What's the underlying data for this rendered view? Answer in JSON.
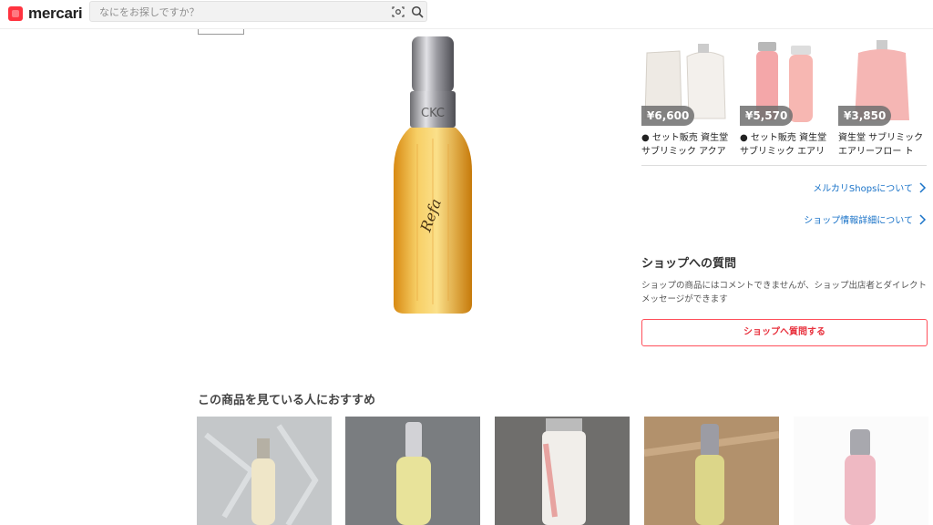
{
  "header": {
    "logo_text": "mercari",
    "search_placeholder": "なにをお探しですか？",
    "icons": [
      "camera-search-icon",
      "search-icon"
    ]
  },
  "right": {
    "recs": [
      {
        "price": "¥6,600",
        "title": "● セット販売 資生堂 サブリミック アクアイ…"
      },
      {
        "price": "¥5,570",
        "title": "● セット販売 資生堂 サブリミック エアリー…"
      },
      {
        "price": "¥3,850",
        "title": "資生堂 サブリミック エアリーフロー トリ…"
      }
    ],
    "links": {
      "about_shops": "メルカリShopsについて",
      "shop_details": "ショップ情報詳細について"
    },
    "question": {
      "title": "ショップへの質問",
      "text": "ショップの商品にはコメントできませんが、ショップ出店者とダイレクトメッセージができます",
      "button": "ショップへ質問する"
    }
  },
  "recommend": {
    "title": "この商品を見ている人におすすめ"
  },
  "colors": {
    "accent": "#ff333f",
    "link": "#1a73c8",
    "button_border": "#ff4f5a"
  }
}
